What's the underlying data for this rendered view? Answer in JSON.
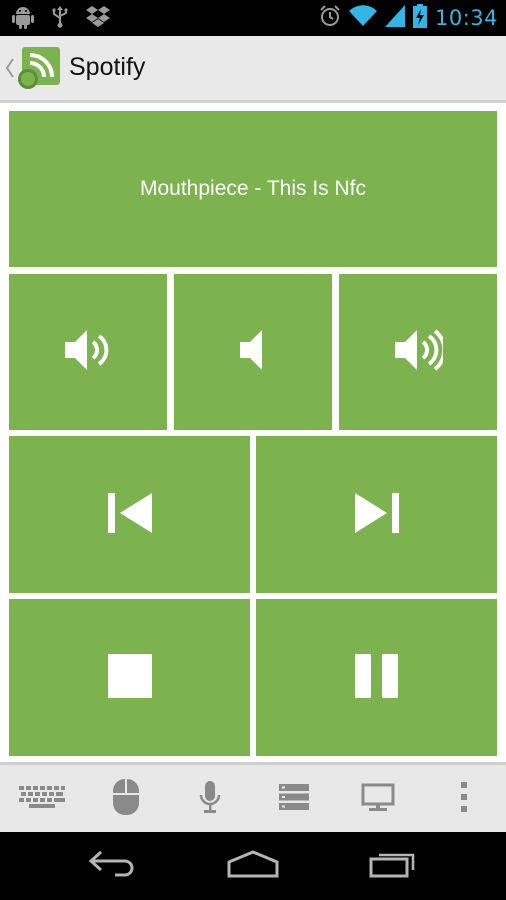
{
  "status_bar": {
    "time": "10:34",
    "icons": [
      "android-debug-icon",
      "usb-icon",
      "dropbox-icon",
      "alarm-icon",
      "wifi-icon",
      "signal-icon",
      "battery-charging-icon"
    ]
  },
  "action_bar": {
    "title": "Spotify",
    "icons": [
      "up-chevron-icon",
      "app-logo-icon"
    ]
  },
  "now_playing": {
    "track": "Mouthpiece - This Is Nfc"
  },
  "controls": {
    "volume": [
      "volume-down-icon",
      "mute-icon",
      "volume-up-icon"
    ],
    "transport": [
      "previous-icon",
      "next-icon",
      "stop-icon",
      "pause-icon"
    ]
  },
  "toolbar": {
    "icons": [
      "keyboard-icon",
      "mouse-icon",
      "microphone-icon",
      "list-icon",
      "monitor-icon",
      "overflow-menu-icon"
    ]
  },
  "nav_bar": {
    "icons": [
      "back-icon",
      "home-icon",
      "recent-apps-icon"
    ]
  },
  "colors": {
    "tile": "#7cb34f",
    "accent": "#33b5e5",
    "toolbar": "#e8e8e8"
  }
}
